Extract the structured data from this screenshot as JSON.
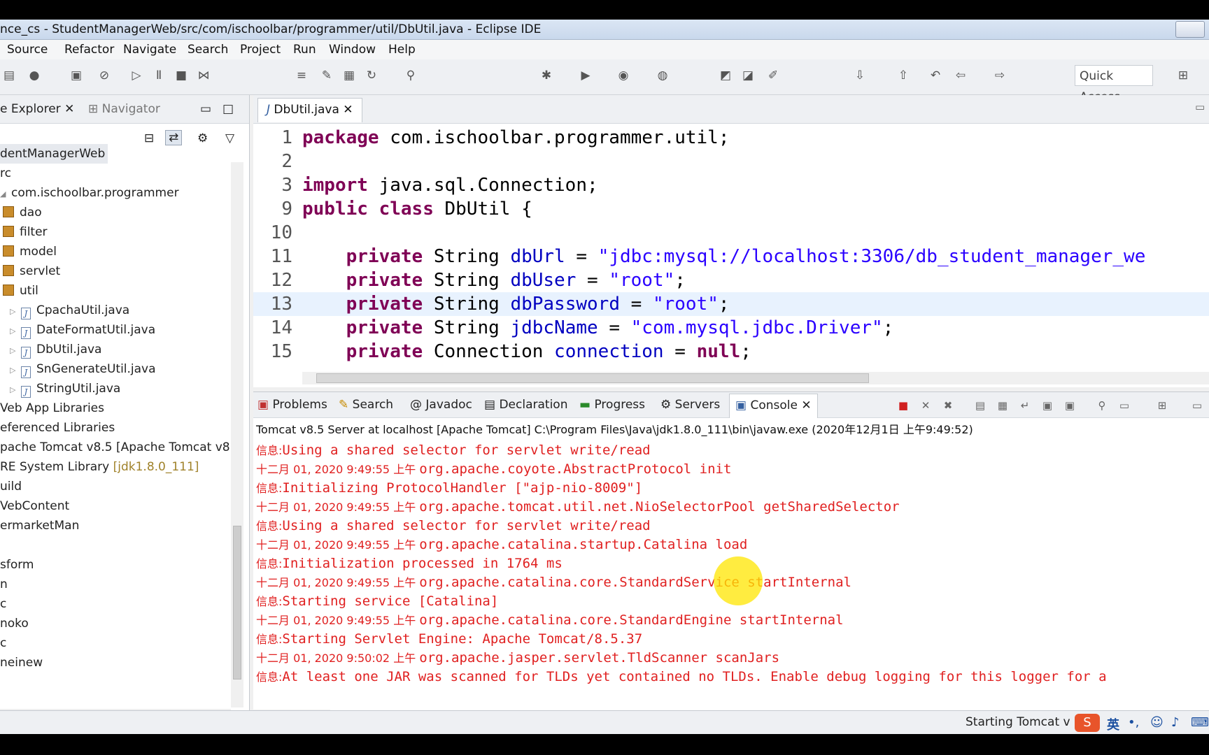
{
  "window": {
    "title": "nce_cs - StudentManagerWeb/src/com/ischoolbar/programmer/util/DbUtil.java - Eclipse IDE"
  },
  "menu": [
    "Source",
    "Refactor",
    "Navigate",
    "Search",
    "Project",
    "Run",
    "Window",
    "Help"
  ],
  "toolbar": {
    "quick_access": "Quick Access"
  },
  "explorer": {
    "tab_label": "e Explorer",
    "navigator_label": "Navigator",
    "tree": [
      {
        "label": "dentManagerWeb",
        "kind": "project"
      },
      {
        "label": "rc",
        "kind": "folder"
      },
      {
        "label": "com.ischoolbar.programmer",
        "kind": "folder"
      },
      {
        "label": "dao",
        "kind": "package"
      },
      {
        "label": "filter",
        "kind": "package"
      },
      {
        "label": "model",
        "kind": "package"
      },
      {
        "label": "servlet",
        "kind": "package"
      },
      {
        "label": "util",
        "kind": "package"
      },
      {
        "label": "CpachaUtil.java",
        "kind": "file"
      },
      {
        "label": "DateFormatUtil.java",
        "kind": "file"
      },
      {
        "label": "DbUtil.java",
        "kind": "file"
      },
      {
        "label": "SnGenerateUtil.java",
        "kind": "file"
      },
      {
        "label": "StringUtil.java",
        "kind": "file"
      },
      {
        "label": "Veb App Libraries",
        "kind": "lib"
      },
      {
        "label": "eferenced Libraries",
        "kind": "lib"
      },
      {
        "label": "pache Tomcat v8.5 [Apache Tomcat v8.5",
        "kind": "lib"
      },
      {
        "label": "RE System Library",
        "extra": "[jdk1.8.0_111]",
        "kind": "lib"
      },
      {
        "label": "uild",
        "kind": "folder"
      },
      {
        "label": "VebContent",
        "kind": "folder"
      },
      {
        "label": "ermarketMan",
        "kind": "project"
      },
      {
        "label": "",
        "kind": "blank"
      },
      {
        "label": "sform",
        "kind": "project"
      },
      {
        "label": "n",
        "kind": "project"
      },
      {
        "label": "c",
        "kind": "project"
      },
      {
        "label": "noko",
        "kind": "project"
      },
      {
        "label": "c",
        "kind": "project"
      },
      {
        "label": "neinew",
        "kind": "project"
      }
    ]
  },
  "editor": {
    "tab_label": "DbUtil.java",
    "lines": [
      {
        "n": "1",
        "parts": [
          [
            "kw",
            "package"
          ],
          [
            "t",
            " com.ischoolbar.programmer.util;"
          ]
        ]
      },
      {
        "n": "2",
        "parts": []
      },
      {
        "n": "3",
        "parts": [
          [
            "kw",
            "import"
          ],
          [
            "t",
            " java.sql.Connection;"
          ]
        ]
      },
      {
        "n": "9",
        "parts": [
          [
            "kw",
            "public"
          ],
          [
            "t",
            " "
          ],
          [
            "kw",
            "class"
          ],
          [
            "t",
            " DbUtil {"
          ]
        ]
      },
      {
        "n": "10",
        "parts": []
      },
      {
        "n": "11",
        "parts": [
          [
            "t",
            "    "
          ],
          [
            "kw",
            "private"
          ],
          [
            "t",
            " String "
          ],
          [
            "fld",
            "dbUrl"
          ],
          [
            "t",
            " = "
          ],
          [
            "str",
            "\"jdbc:mysql://localhost:3306/db_student_manager_we"
          ]
        ]
      },
      {
        "n": "12",
        "parts": [
          [
            "t",
            "    "
          ],
          [
            "kw",
            "private"
          ],
          [
            "t",
            " String "
          ],
          [
            "fld",
            "dbUser"
          ],
          [
            "t",
            " = "
          ],
          [
            "str",
            "\"root\""
          ],
          [
            "t",
            ";"
          ]
        ]
      },
      {
        "n": "13",
        "parts": [
          [
            "t",
            "    "
          ],
          [
            "kw",
            "private"
          ],
          [
            "t",
            " String "
          ],
          [
            "fld",
            "dbPassword"
          ],
          [
            "t",
            " = "
          ],
          [
            "str",
            "\"root\""
          ],
          [
            "t",
            ";"
          ]
        ],
        "current": true
      },
      {
        "n": "14",
        "parts": [
          [
            "t",
            "    "
          ],
          [
            "kw",
            "private"
          ],
          [
            "t",
            " String "
          ],
          [
            "fld",
            "jdbcName"
          ],
          [
            "t",
            " = "
          ],
          [
            "str",
            "\"com.mysql.jdbc.Driver\""
          ],
          [
            "t",
            ";"
          ]
        ]
      },
      {
        "n": "15",
        "parts": [
          [
            "t",
            "    "
          ],
          [
            "kw",
            "private"
          ],
          [
            "t",
            " Connection "
          ],
          [
            "fld",
            "connection"
          ],
          [
            "t",
            " = "
          ],
          [
            "kw",
            "null"
          ],
          [
            "t",
            ";"
          ]
        ]
      }
    ]
  },
  "console": {
    "tabs": [
      "Problems",
      "Search",
      "Javadoc",
      "Declaration",
      "Progress",
      "Servers",
      "Console"
    ],
    "active_tab": "Console",
    "description": "Tomcat v8.5 Server at localhost [Apache Tomcat] C:\\Program Files\\Java\\jdk1.8.0_111\\bin\\javaw.exe (2020年12月1日 上午9:49:52)",
    "lines": [
      {
        "prefix": "信息:",
        "text": "Using a shared selector for servlet write/read"
      },
      {
        "prefix": "十二月 01, 2020 9:49:55 上午 ",
        "text": "org.apache.coyote.AbstractProtocol init"
      },
      {
        "prefix": "信息:",
        "text": "Initializing ProtocolHandler [\"ajp-nio-8009\"]"
      },
      {
        "prefix": "十二月 01, 2020 9:49:55 上午 ",
        "text": "org.apache.tomcat.util.net.NioSelectorPool getSharedSelector"
      },
      {
        "prefix": "信息:",
        "text": "Using a shared selector for servlet write/read"
      },
      {
        "prefix": "十二月 01, 2020 9:49:55 上午 ",
        "text": "org.apache.catalina.startup.Catalina load"
      },
      {
        "prefix": "信息:",
        "text": "Initialization processed in 1764 ms"
      },
      {
        "prefix": "十二月 01, 2020 9:49:55 上午 ",
        "text": "org.apache.catalina.core.StandardService startInternal"
      },
      {
        "prefix": "信息:",
        "text": "Starting service [Catalina]"
      },
      {
        "prefix": "十二月 01, 2020 9:49:55 上午 ",
        "text": "org.apache.catalina.core.StandardEngine startInternal"
      },
      {
        "prefix": "信息:",
        "text": "Starting Servlet Engine: Apache Tomcat/8.5.37"
      },
      {
        "prefix": "十二月 01, 2020 9:50:02 上午 ",
        "text": "org.apache.jasper.servlet.TldScanner scanJars"
      },
      {
        "prefix": "信息:",
        "text": "At least one JAR was scanned for TLDs yet contained no TLDs. Enable debug logging for this logger for a"
      }
    ]
  },
  "status": {
    "text": "Starting Tomcat v",
    "ime_label": "英"
  }
}
